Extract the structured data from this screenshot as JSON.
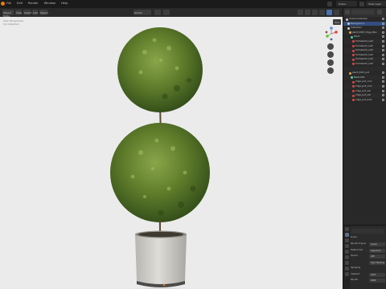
{
  "app": {
    "accent": "#e87d0d",
    "selection_color": "#334d80"
  },
  "topbar": {
    "menu": [
      "File",
      "Edit",
      "Render",
      "Window",
      "Help"
    ],
    "scene": "Scene",
    "view_layer": "View Layer"
  },
  "viewport": {
    "header": {
      "mode": "Object Mode",
      "menus": [
        "View",
        "Select",
        "Add",
        "Object"
      ],
      "transform": "Global"
    },
    "info_lines": [
      "User Perspective",
      "(1) Collection"
    ],
    "tool_button": "Tool",
    "background": "#ebebeb"
  },
  "outliner": {
    "rows": [
      {
        "label": "Scene Collection",
        "indent": 2,
        "icon": "collection-icon",
        "color": "#cccccc"
      },
      {
        "label": "Background",
        "indent": 4,
        "icon": "collection-icon",
        "color": "#cccccc",
        "selected": true
      },
      {
        "label": "Collection",
        "indent": 4,
        "icon": "collection-icon",
        "color": "#cccccc"
      },
      {
        "label": "plant_ID03_Cliga_Plan",
        "indent": 6,
        "icon": "object-icon",
        "color": "#e8a64a"
      },
      {
        "label": "Mesh",
        "indent": 8,
        "icon": "mesh-icon",
        "color": "#4ad29a"
      },
      {
        "label": "framework_leaf",
        "indent": 10,
        "icon": "material-icon",
        "color": "#e04444"
      },
      {
        "label": "framework_leaf",
        "indent": 10,
        "icon": "material-icon",
        "color": "#e04444"
      },
      {
        "label": "framework_leaf",
        "indent": 10,
        "icon": "material-icon",
        "color": "#e04444"
      },
      {
        "label": "framework_leaf",
        "indent": 10,
        "icon": "material-icon",
        "color": "#e04444"
      },
      {
        "label": "framework_leaf",
        "indent": 10,
        "icon": "material-icon",
        "color": "#e04444"
      },
      {
        "label": "framework_leaf",
        "indent": 10,
        "icon": "material-icon",
        "color": "#e04444"
      },
      {
        "label": "",
        "indent": 6,
        "icon": "",
        "color": "#cccccc"
      },
      {
        "label": "plant_ID03_pot",
        "indent": 6,
        "icon": "object-icon",
        "color": "#e8a64a"
      },
      {
        "label": "Mesh.001",
        "indent": 8,
        "icon": "mesh-icon",
        "color": "#4ad29a"
      },
      {
        "label": "Cliga_pot_conc",
        "indent": 10,
        "icon": "material-icon",
        "color": "#e04444"
      },
      {
        "label": "Cliga_pot_conc",
        "indent": 10,
        "icon": "material-icon",
        "color": "#e04444"
      },
      {
        "label": "Cliga_pot_soil",
        "indent": 10,
        "icon": "material-icon",
        "color": "#e04444"
      },
      {
        "label": "Cliga_pot_soil",
        "indent": 10,
        "icon": "material-icon",
        "color": "#e04444"
      },
      {
        "label": "Cliga_pot_bark",
        "indent": 10,
        "icon": "material-icon",
        "color": "#e04444"
      }
    ]
  },
  "properties": {
    "section": "Scene",
    "rows": [
      {
        "label": "Render Engine",
        "value": "Cycles"
      },
      {
        "label": "Feature Set",
        "value": "Supported"
      },
      {
        "label": "Device",
        "value": "GPU"
      },
      {
        "label": "",
        "value": "Open Shading"
      },
      {
        "label": "Sampling",
        "value": ""
      },
      {
        "label": "Viewport",
        "value": "1024"
      },
      {
        "label": "Render",
        "value": "4096"
      }
    ]
  }
}
